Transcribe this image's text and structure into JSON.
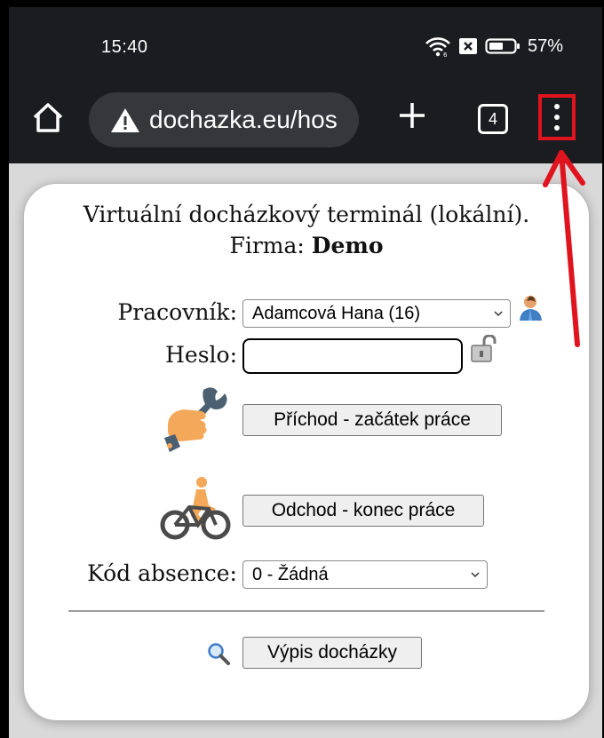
{
  "status_bar": {
    "time": "15:40",
    "battery_percent": "57%",
    "icons": [
      "wifi-icon",
      "notification-icon",
      "battery-icon"
    ]
  },
  "browser": {
    "url": "dochazka.eu/hos",
    "tab_count": "4",
    "icons": [
      "home-icon",
      "warning-icon",
      "plus-icon",
      "more-vert-icon"
    ],
    "highlight_color": "#e0141e"
  },
  "terminal": {
    "title": "Virtuální docházkový terminál (lokální).",
    "company_label": "Firma:",
    "company_name": "Demo",
    "employee_label": "Pracovník:",
    "employee_selected": "Adamcová Hana (16)",
    "password_label": "Heslo:",
    "password_value": "",
    "arrival_button": "Příchod - začátek práce",
    "departure_button": "Odchod - konec práce",
    "absence_label": "Kód absence:",
    "absence_selected": "0 - Žádná",
    "report_button": "Výpis docházky"
  }
}
